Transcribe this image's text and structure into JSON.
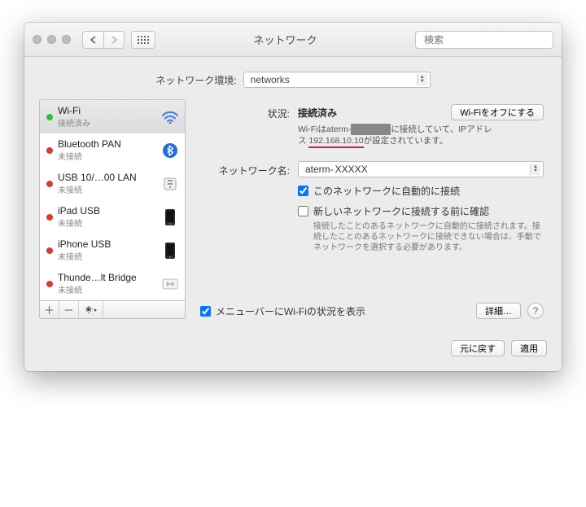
{
  "window": {
    "title": "ネットワーク",
    "search_placeholder": "検索"
  },
  "location": {
    "label": "ネットワーク環境:",
    "value": "networks"
  },
  "sidebar": {
    "items": [
      {
        "name": "Wi-Fi",
        "status": "接続済み",
        "dot": "green",
        "icon": "wifi"
      },
      {
        "name": "Bluetooth PAN",
        "status": "未接続",
        "dot": "red",
        "icon": "bluetooth"
      },
      {
        "name": "USB 10/…00 LAN",
        "status": "未接続",
        "dot": "red",
        "icon": "usb"
      },
      {
        "name": "iPad USB",
        "status": "未接続",
        "dot": "red",
        "icon": "device"
      },
      {
        "name": "iPhone USB",
        "status": "未接続",
        "dot": "red",
        "icon": "device"
      },
      {
        "name": "Thunde…lt Bridge",
        "status": "未接続",
        "dot": "red",
        "icon": "bridge"
      }
    ]
  },
  "main": {
    "status_label": "状況:",
    "status_value": "接続済み",
    "wifi_off_btn": "Wi-Fiをオフにする",
    "status_desc_prefix": "Wi-Fiはaterm-",
    "status_desc_mid": "に接続していて、IPアドレ",
    "status_desc_ip_prefix": "ス ",
    "status_desc_ip": "192.168.10.10",
    "status_desc_suffix": "が設定されています。",
    "network_name_label": "ネットワーク名:",
    "network_name_value": "aterm-",
    "auto_join": "このネットワークに自動的に接続",
    "ask_join": "新しいネットワークに接続する前に確認",
    "ask_join_desc": "接続したことのあるネットワークに自動的に接続されます。接続したことのあるネットワークに接続できない場合は、手動でネットワークを選択する必要があります。",
    "menubar": "メニューバーにWi-Fiの状況を表示",
    "advanced_btn": "詳細…"
  },
  "bottom": {
    "revert": "元に戻す",
    "apply": "適用"
  }
}
